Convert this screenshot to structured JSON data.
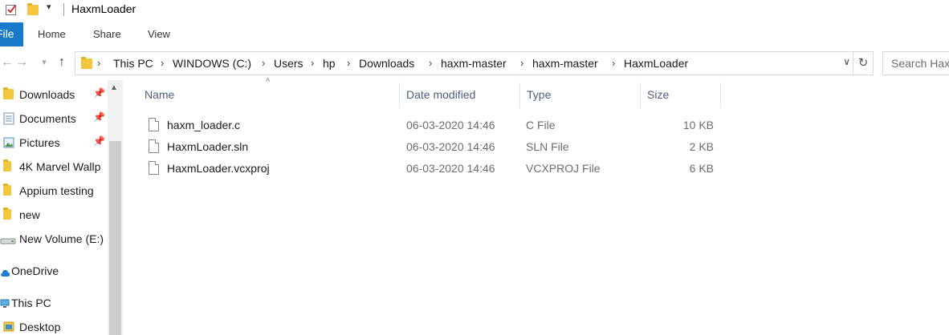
{
  "window": {
    "title": "HaxmLoader"
  },
  "ribbon": {
    "file_label": "File",
    "tabs": [
      "Home",
      "Share",
      "View"
    ]
  },
  "address": {
    "crumbs": [
      "This PC",
      "WINDOWS (C:)",
      "Users",
      "hp",
      "Downloads",
      "haxm-master",
      "haxm-master",
      "HaxmLoader"
    ]
  },
  "search": {
    "placeholder": "Search HaxmLoader"
  },
  "nav": {
    "items": [
      {
        "label": "Downloads",
        "icon": "downloads-folder-icon",
        "pinned": true
      },
      {
        "label": "Documents",
        "icon": "documents-icon",
        "pinned": true
      },
      {
        "label": "Pictures",
        "icon": "pictures-icon",
        "pinned": true
      },
      {
        "label": "4K Marvel Wallp",
        "icon": "folder-icon",
        "pinned": false
      },
      {
        "label": "Appium testing",
        "icon": "folder-icon",
        "pinned": false
      },
      {
        "label": "new",
        "icon": "folder-icon",
        "pinned": false
      },
      {
        "label": "New Volume (E:)",
        "icon": "drive-icon",
        "pinned": false
      },
      {
        "label": "OneDrive",
        "icon": "cloud-icon",
        "pinned": false
      },
      {
        "label": "This PC",
        "icon": "computer-icon",
        "pinned": false
      },
      {
        "label": "Desktop",
        "icon": "desktop-icon",
        "pinned": false
      }
    ]
  },
  "columns": {
    "name": "Name",
    "date": "Date modified",
    "type": "Type",
    "size": "Size"
  },
  "files": [
    {
      "name": "haxm_loader.c",
      "date": "06-03-2020 14:46",
      "type": "C File",
      "size": "10 KB"
    },
    {
      "name": "HaxmLoader.sln",
      "date": "06-03-2020 14:46",
      "type": "SLN File",
      "size": "2 KB"
    },
    {
      "name": "HaxmLoader.vcxproj",
      "date": "06-03-2020 14:46",
      "type": "VCXPROJ File",
      "size": "6 KB"
    }
  ],
  "colors": {
    "accent": "#1979ca",
    "header_text": "#4c607a",
    "folder": "#f3c63f"
  }
}
